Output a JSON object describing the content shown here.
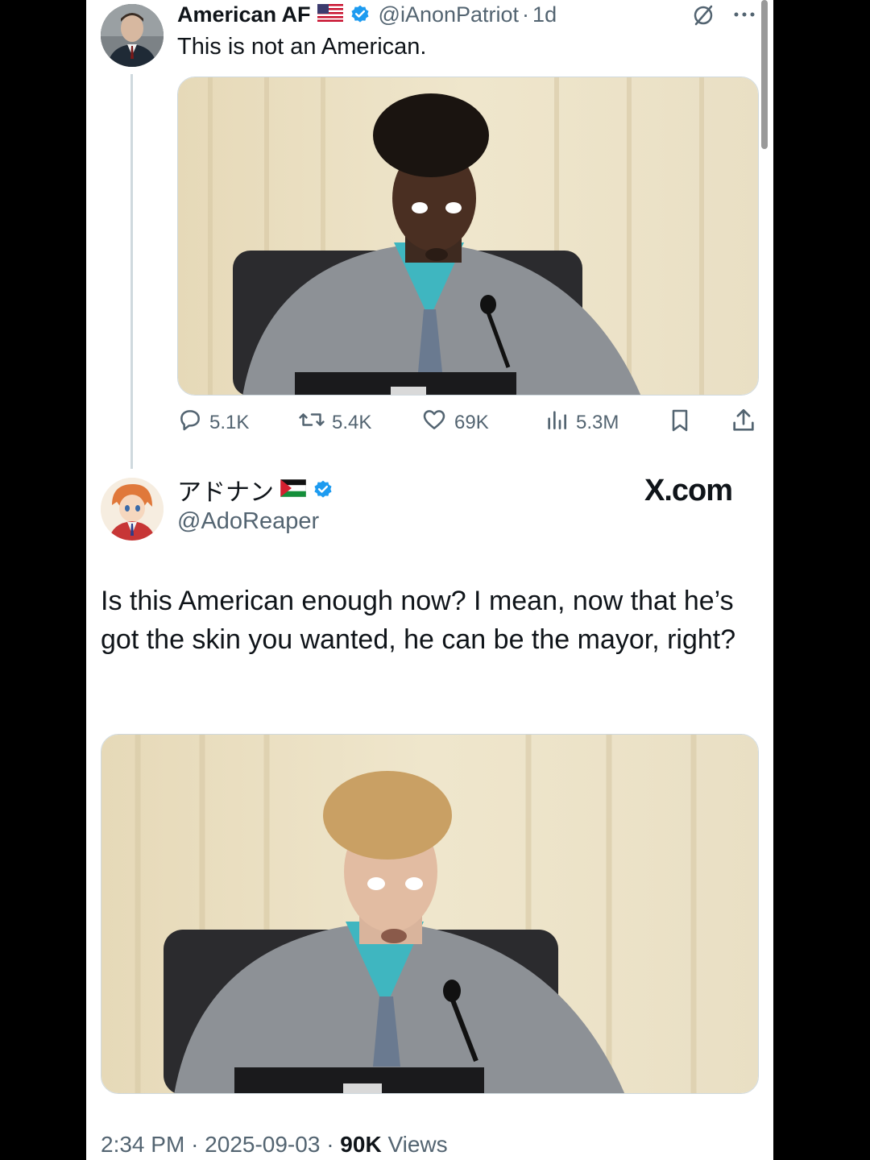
{
  "quoted_tweet": {
    "display_name": "American AF",
    "flag_icon": "us-flag-icon",
    "handle": "@iAnonPatriot",
    "dot": "·",
    "time": "1d",
    "text": "This is not an American.",
    "stats": {
      "replies": "5.1K",
      "reposts": "5.4K",
      "likes": "69K",
      "views": "5.3M"
    }
  },
  "reply_tweet": {
    "display_name": "アドナン",
    "flag_icon": "palestine-flag-icon",
    "handle": "@AdoReaper",
    "text": "Is this American enough now? I mean, now that he’s got the skin you wanted, he can be the mayor, right?",
    "timestamp": "2:34 PM",
    "date": "2025-09-03",
    "views_count": "90K",
    "views_label": "Views",
    "dot": "·"
  },
  "watermark": "X.com",
  "colors": {
    "verified_blue": "#1d9bf0",
    "secondary_text": "#536471",
    "primary_text": "#0f1419",
    "border": "#cfd9de"
  }
}
